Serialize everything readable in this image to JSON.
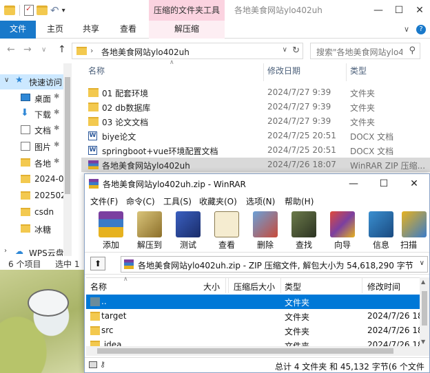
{
  "explorer": {
    "window_title": "各地美食网站ylo402uh",
    "context_tab_group": "压缩的文件夹工具",
    "ribbon_tabs": [
      "文件",
      "主页",
      "共享",
      "查看",
      "解压缩"
    ],
    "address": "各地美食网站ylo402uh",
    "search_placeholder": "搜索\"各地美食网站ylo4...",
    "columns": {
      "name": "名称",
      "date": "修改日期",
      "type": "类型"
    },
    "files": [
      {
        "name": "01 配套环境",
        "date": "2024/7/27 9:39",
        "type": "文件夹",
        "icon": "folder-icon"
      },
      {
        "name": "02 db数据库",
        "date": "2024/7/27 9:39",
        "type": "文件夹",
        "icon": "folder-icon"
      },
      {
        "name": "03 论文文档",
        "date": "2024/7/27 9:39",
        "type": "文件夹",
        "icon": "folder-icon"
      },
      {
        "name": "biye论文",
        "date": "2024/7/25 20:51",
        "type": "DOCX 文档",
        "icon": "word-doc-icon"
      },
      {
        "name": "springboot+vue环境配置文档",
        "date": "2024/7/25 20:51",
        "type": "DOCX 文档",
        "icon": "word-doc-icon"
      },
      {
        "name": "各地美食网站ylo402uh",
        "date": "2024/7/26 18:07",
        "type": "WinRAR ZIP 压缩...",
        "icon": "winrar-zip-icon"
      }
    ],
    "nav_items": [
      {
        "label": "快速访问",
        "icon": "star-icon"
      },
      {
        "label": "桌面",
        "icon": "desktop-icon"
      },
      {
        "label": "下载",
        "icon": "download-icon"
      },
      {
        "label": "文档",
        "icon": "documents-icon"
      },
      {
        "label": "图片",
        "icon": "pictures-icon"
      },
      {
        "label": "各地",
        "icon": "folder-icon"
      },
      {
        "label": "2024-0",
        "icon": "folder-icon"
      },
      {
        "label": "202502",
        "icon": "folder-icon"
      },
      {
        "label": "csdn",
        "icon": "folder-icon"
      },
      {
        "label": "冰糖",
        "icon": "folder-icon"
      },
      {
        "label": "WPS云盘",
        "icon": "cloud-icon"
      }
    ],
    "status": {
      "count": "6 个项目",
      "selected": "选中 1"
    }
  },
  "winrar": {
    "title": "各地美食网站ylo402uh.zip - WinRAR",
    "menus": [
      "文件(F)",
      "命令(C)",
      "工具(S)",
      "收藏夹(O)",
      "选项(N)",
      "帮助(H)"
    ],
    "tools": [
      {
        "label": "添加",
        "icon": "add-archive-icon"
      },
      {
        "label": "解压到",
        "icon": "extract-to-icon"
      },
      {
        "label": "测试",
        "icon": "test-icon"
      },
      {
        "label": "查看",
        "icon": "view-icon"
      },
      {
        "label": "删除",
        "icon": "delete-icon"
      },
      {
        "label": "查找",
        "icon": "find-icon"
      },
      {
        "label": "向导",
        "icon": "wizard-icon"
      },
      {
        "label": "信息",
        "icon": "info-icon"
      },
      {
        "label": "扫描",
        "icon": "scan-icon"
      }
    ],
    "path": "各地美食网站ylo402uh.zip - ZIP 压缩文件, 解包大小为 54,618,290 字节",
    "columns": {
      "name": "名称",
      "size": "大小",
      "packed": "压缩后大小",
      "type": "类型",
      "modified": "修改时间"
    },
    "rows": [
      {
        "name": "..",
        "type": "文件夹",
        "modified": ""
      },
      {
        "name": "target",
        "type": "文件夹",
        "modified": "2024/7/26 18"
      },
      {
        "name": "src",
        "type": "文件夹",
        "modified": "2024/7/26 18"
      },
      {
        "name": ".idea",
        "type": "文件夹",
        "modified": "2024/7/26 18"
      }
    ],
    "status_text": "总计 4 文件夹 和 45,132 字节(6 个文件"
  }
}
